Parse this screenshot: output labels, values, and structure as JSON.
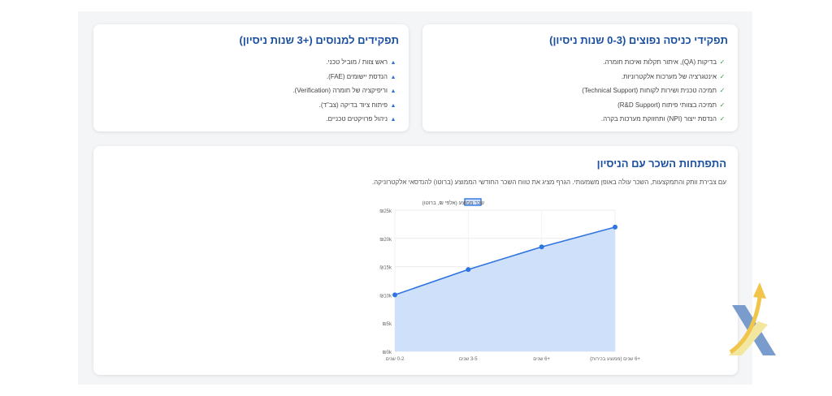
{
  "entry_card": {
    "title": "תפקידי כניסה נפוצים (0-3 שנות ניסיון)",
    "items": [
      "בדיקות (QA), איתור תקלות ואיכות חומרה.",
      "אינטגרציה של מערכות אלקטרוניות.",
      "תמיכה טכנית ושירות לקוחות (Technical Support)",
      "תמיכה בצוותי פיתוח (R&D Support)",
      "הנדסת ייצור (NPI) ותחזוקת מערכות בקרה."
    ],
    "marker_icon": "check-icon",
    "marker_color": "#2e9e4f"
  },
  "senior_card": {
    "title": "תפקידים למנוסים (+3 שנות ניסיון)",
    "items": [
      "ראש צוות / מוביל טכני.",
      "הנדסת יישומים (FAE).",
      "וריפיקציה של חומרה (Verification).",
      "פיתוח ציוד בדיקה (צב\"ד).",
      "ניהול פרויקטים טכניים."
    ],
    "marker_icon": "triangle-icon",
    "marker_color": "#2f6fd6"
  },
  "salary_section": {
    "title": "התפתחות השכר עם הניסיון",
    "description": "עם צבירת וותק והתמקצעות, השכר עולה באופן משמעותי. הגרף מציג את טווח השכר החודשי הממוצע (ברוטו) להנדסאי אלקטרוניקה."
  },
  "chart_data": {
    "type": "area",
    "categories": [
      "0-2 שנים",
      "3-5 שנים",
      "+6 שנים",
      "+6 שנים (ממוצע בכירות)"
    ],
    "series": [
      {
        "name": "שכר ממוצע (אלפי ₪, ברוטו)",
        "values": [
          10,
          14.5,
          18.5,
          22
        ]
      }
    ],
    "ylim": [
      0,
      25
    ],
    "yticks": [
      0,
      5,
      10,
      15,
      20,
      25
    ],
    "ytick_labels": [
      "₪0k",
      "₪5k",
      "₪10k",
      "₪15k",
      "₪20k",
      "₪25k"
    ],
    "grid": true,
    "legend": "top-center",
    "line_color": "#2f74e0",
    "fill_color": "#cfe0fb"
  },
  "logo": {
    "icon": "logo-x-arrow-icon"
  }
}
